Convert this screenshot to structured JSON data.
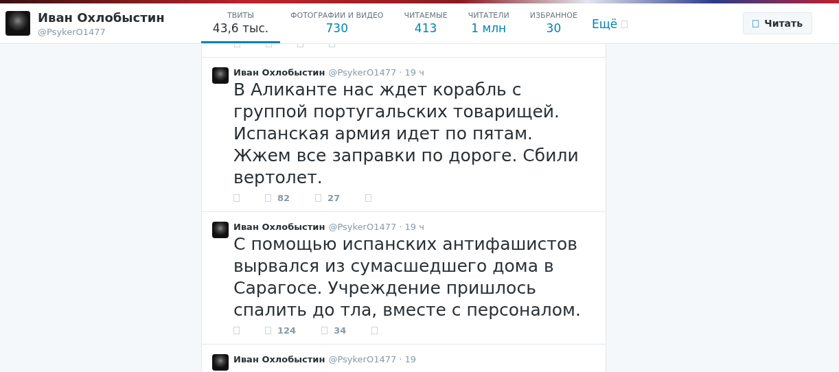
{
  "profile": {
    "name": "Иван Охлобыстин",
    "handle": "@PsykerO1477"
  },
  "nav": [
    {
      "label": "ТВИТЫ",
      "value": "43,6 тыс.",
      "selected": true
    },
    {
      "label": "ФОТОГРАФИИ И ВИДЕО",
      "value": "730",
      "selected": false
    },
    {
      "label": "ЧИТАЕМЫЕ",
      "value": "413",
      "selected": false
    },
    {
      "label": "ЧИТАТЕЛИ",
      "value": "1 млн",
      "selected": false
    },
    {
      "label": "ИЗБРАННОЕ",
      "value": "30",
      "selected": false
    }
  ],
  "more": "Ещё",
  "follow_button": "Читать",
  "tweets": [
    {
      "name": "Иван Охлобыстин",
      "handle": "@PsykerO1477",
      "time": "· 19 ч",
      "text": "В Аликанте нас ждет корабль с группой португальских товарищей. Испанская армия идет по пятам. Жжем все заправки по дороге. Сбили вертолет.",
      "retweets": "82",
      "likes": "27"
    },
    {
      "name": "Иван Охлобыстин",
      "handle": "@PsykerO1477",
      "time": "· 19 ч",
      "text": "С помощью испанских антифашистов вырвался из сумасшедшего дома в Сарагосе. Учреждение пришлось спалить до тла, вместе с персоналом.",
      "retweets": "124",
      "likes": "34"
    },
    {
      "name": "Иван Охлобыстин",
      "handle": "@PsykerO1477",
      "time": "· 19"
    }
  ]
}
